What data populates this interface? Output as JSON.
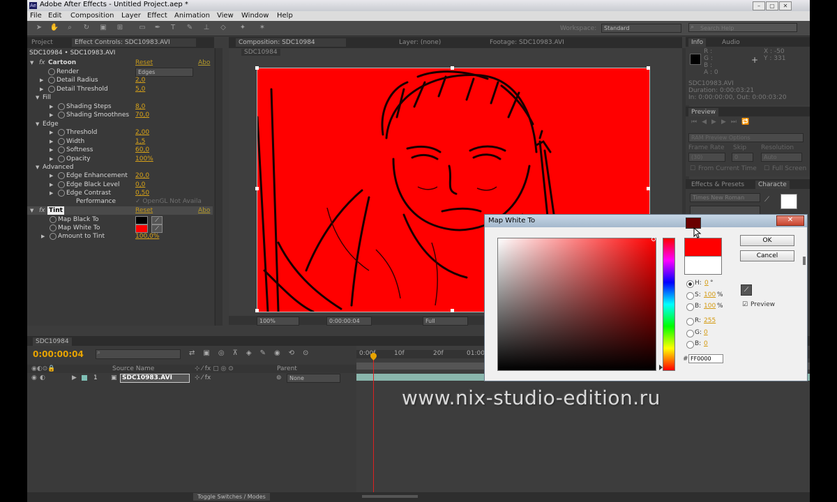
{
  "window": {
    "title": "Adobe After Effects - Untitled Project.aep *",
    "app_icon": "Ae"
  },
  "menu": [
    "File",
    "Edit",
    "Composition",
    "Layer",
    "Effect",
    "Animation",
    "View",
    "Window",
    "Help"
  ],
  "workspace": {
    "label": "Workspace:",
    "value": "Standard",
    "search_placeholder": "Search Help"
  },
  "left_panel": {
    "tabs": [
      "Project",
      "Effect Controls: SDC10983.AVI"
    ],
    "header": "SDC10984 • SDC10983.AVI",
    "reset_label": "Reset",
    "about_label": "Abo",
    "cartoon": {
      "name": "Cartoon"
    },
    "properties": [
      {
        "name": "Render",
        "value": "Edges",
        "type": "dropdown",
        "indent": 2
      },
      {
        "name": "Detail Radius",
        "value": "2,0",
        "indent": 2
      },
      {
        "name": "Detail Threshold",
        "value": "5,0",
        "indent": 2
      },
      {
        "name": "Fill",
        "value": "",
        "indent": 1,
        "group": true
      },
      {
        "name": "Shading Steps",
        "value": "8,0",
        "indent": 3
      },
      {
        "name": "Shading Smoothnes",
        "value": "70,0",
        "indent": 3
      },
      {
        "name": "Edge",
        "value": "",
        "indent": 1,
        "group": true
      },
      {
        "name": "Threshold",
        "value": "2,00",
        "indent": 3
      },
      {
        "name": "Width",
        "value": "1,5",
        "indent": 3
      },
      {
        "name": "Softness",
        "value": "60,0",
        "indent": 3
      },
      {
        "name": "Opacity",
        "value": "100%",
        "indent": 3
      },
      {
        "name": "Advanced",
        "value": "",
        "indent": 1,
        "group": true
      },
      {
        "name": "Edge Enhancement",
        "value": "20,0",
        "indent": 3
      },
      {
        "name": "Edge Black Level",
        "value": "0,0",
        "indent": 3
      },
      {
        "name": "Edge Contrast",
        "value": "0,50",
        "indent": 3
      }
    ],
    "performance": {
      "label": "Performance",
      "value": "✓ OpenGL Not Availa"
    },
    "tint": {
      "name": "Tint",
      "map_black": "Map Black To",
      "map_white": "Map White To",
      "amount_label": "Amount to Tint",
      "amount_value": "100,0%",
      "black_color": "#000000",
      "white_color": "#ff0000"
    }
  },
  "comp_panel": {
    "tabs": [
      "Composition: SDC10984",
      "Layer: (none)",
      "Footage: SDC10983.AVI"
    ],
    "sub_tab": "SDC10984",
    "zoom": "100%",
    "timecode": "0:00:00:04",
    "quality": "Full"
  },
  "info_panel": {
    "tabs": [
      "Info",
      "Audio"
    ],
    "r": "R :",
    "g": "G :",
    "b": "B :",
    "a": "A : 0",
    "x": "X : -50",
    "y": "Y : 331",
    "clip": "SDC10983.AVI",
    "duration": "Duration: 0:00:03:21",
    "inout": "In: 0:00:00:00, Out: 0:00:03:20"
  },
  "preview_panel": {
    "tab": "Preview",
    "ram": "RAM Preview Options",
    "frame_rate_label": "Frame Rate",
    "skip_label": "Skip",
    "resolution_label": "Resolution",
    "frame_rate": "(30)",
    "skip": "0",
    "resolution": "Auto",
    "from_current": "From Current Time",
    "full_screen": "Full Screen"
  },
  "effects_panel": {
    "tabs": [
      "Effects & Presets",
      "Characte"
    ],
    "font": "Times New Roman"
  },
  "color_dialog": {
    "title": "Map White To",
    "ok": "OK",
    "cancel": "Cancel",
    "preview": "Preview",
    "h_label": "H:",
    "h_value": "0",
    "h_unit": "°",
    "s_label": "S:",
    "s_value": "100",
    "s_unit": "%",
    "b_label": "B:",
    "b_value": "100",
    "b_unit": "%",
    "r_label": "R:",
    "r_value": "255",
    "g_label": "G:",
    "g_value": "0",
    "bb_label": "B:",
    "bb_value": "0",
    "hex_label": "#",
    "hex": "FF0000",
    "new_color": "#ff0000",
    "old_color": "#ffffff"
  },
  "timeline": {
    "tab": "SDC10984",
    "timecode": "0:00:00:04",
    "cols": {
      "source": "Source Name",
      "parent": "Parent"
    },
    "layer": {
      "num": "1",
      "name": "SDC10983.AVI",
      "parent": "None"
    },
    "ruler": [
      "0:00f",
      "10f",
      "20f",
      "01:00"
    ],
    "toggle": "Toggle Switches / Modes"
  },
  "watermark": "www.nix-studio-edition.ru"
}
